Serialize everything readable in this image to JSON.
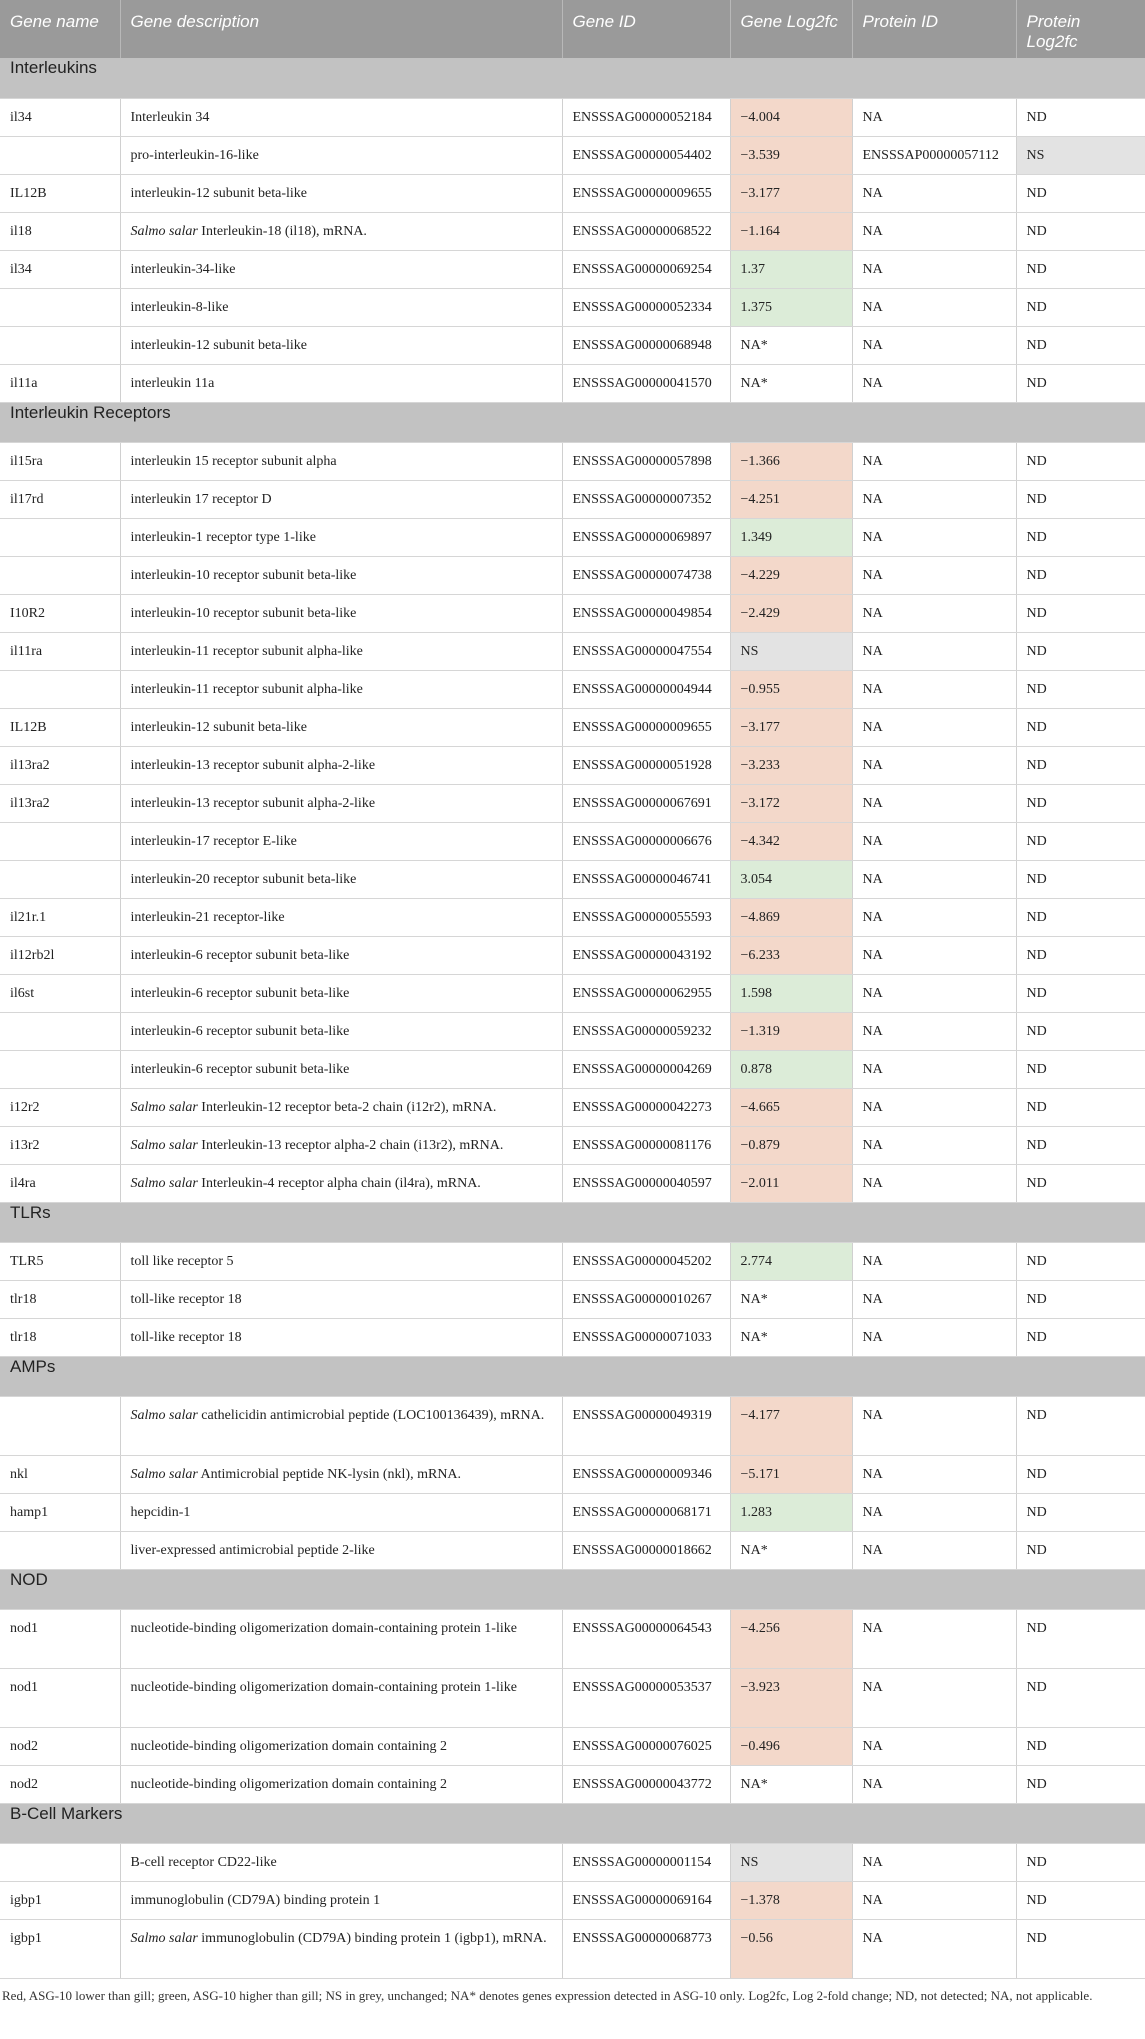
{
  "header": [
    "Gene name",
    "Gene description",
    "Gene ID",
    "Gene Log2fc",
    "Protein ID",
    "Protein Log2fc"
  ],
  "colors": {
    "red": "#f3d8ca",
    "green": "#dcecd8",
    "grey": "#e3e3e3"
  },
  "groups": [
    {
      "title": "Interleukins",
      "rows": [
        {
          "name": "il34",
          "desc": "Interleukin 34",
          "id": "ENSSSAG00000052184",
          "gfc": "−4.004",
          "color": "red",
          "pid": "NA",
          "pfc": "ND"
        },
        {
          "name": "",
          "desc": "pro-interleukin-16-like",
          "id": "ENSSSAG00000054402",
          "gfc": "−3.539",
          "color": "red",
          "pid": "ENSSSAP00000057112",
          "pfc": "NS",
          "pcolor": "grey"
        },
        {
          "name": "IL12B",
          "desc": "interleukin-12 subunit beta-like",
          "id": "ENSSSAG00000009655",
          "gfc": "−3.177",
          "color": "red",
          "pid": "NA",
          "pfc": "ND"
        },
        {
          "name": "il18",
          "desc": "Salmo salar Interleukin-18 (il18), mRNA.",
          "italic": "Salmo salar",
          "id": "ENSSSAG00000068522",
          "gfc": "−1.164",
          "color": "red",
          "pid": "NA",
          "pfc": "ND"
        },
        {
          "name": "il34",
          "desc": "interleukin-34-like",
          "id": "ENSSSAG00000069254",
          "gfc": "1.37",
          "color": "green",
          "pid": "NA",
          "pfc": "ND"
        },
        {
          "name": "",
          "desc": "interleukin-8-like",
          "id": "ENSSSAG00000052334",
          "gfc": "1.375",
          "color": "green",
          "pid": "NA",
          "pfc": "ND"
        },
        {
          "name": "",
          "desc": "interleukin-12 subunit beta-like",
          "id": "ENSSSAG00000068948",
          "gfc": "NA*",
          "color": "",
          "pid": "NA",
          "pfc": "ND"
        },
        {
          "name": "il11a",
          "desc": "interleukin 11a",
          "id": "ENSSSAG00000041570",
          "gfc": "NA*",
          "color": "",
          "pid": "NA",
          "pfc": "ND"
        }
      ]
    },
    {
      "title": "Interleukin Receptors",
      "rows": [
        {
          "name": "il15ra",
          "desc": "interleukin 15 receptor subunit alpha",
          "id": "ENSSSAG00000057898",
          "gfc": "−1.366",
          "color": "red",
          "pid": "NA",
          "pfc": "ND"
        },
        {
          "name": "il17rd",
          "desc": "interleukin 17 receptor D",
          "id": "ENSSSAG00000007352",
          "gfc": "−4.251",
          "color": "red",
          "pid": "NA",
          "pfc": "ND"
        },
        {
          "name": "",
          "desc": "interleukin-1 receptor type 1-like",
          "id": "ENSSSAG00000069897",
          "gfc": "1.349",
          "color": "green",
          "pid": "NA",
          "pfc": "ND"
        },
        {
          "name": "",
          "desc": "interleukin-10 receptor subunit beta-like",
          "id": "ENSSSAG00000074738",
          "gfc": "−4.229",
          "color": "red",
          "pid": "NA",
          "pfc": "ND"
        },
        {
          "name": "I10R2",
          "desc": "interleukin-10 receptor subunit beta-like",
          "id": "ENSSSAG00000049854",
          "gfc": "−2.429",
          "color": "red",
          "pid": "NA",
          "pfc": "ND"
        },
        {
          "name": "il11ra",
          "desc": "interleukin-11 receptor subunit alpha-like",
          "id": "ENSSSAG00000047554",
          "gfc": "NS",
          "color": "grey",
          "pid": "NA",
          "pfc": "ND"
        },
        {
          "name": "",
          "desc": "interleukin-11 receptor subunit alpha-like",
          "id": "ENSSSAG00000004944",
          "gfc": "−0.955",
          "color": "red",
          "pid": "NA",
          "pfc": "ND"
        },
        {
          "name": "IL12B",
          "desc": "interleukin-12 subunit beta-like",
          "id": "ENSSSAG00000009655",
          "gfc": "−3.177",
          "color": "red",
          "pid": "NA",
          "pfc": "ND"
        },
        {
          "name": "il13ra2",
          "desc": "interleukin-13 receptor subunit alpha-2-like",
          "id": "ENSSSAG00000051928",
          "gfc": "−3.233",
          "color": "red",
          "pid": "NA",
          "pfc": "ND"
        },
        {
          "name": "il13ra2",
          "desc": "interleukin-13 receptor subunit alpha-2-like",
          "id": "ENSSSAG00000067691",
          "gfc": "−3.172",
          "color": "red",
          "pid": "NA",
          "pfc": "ND"
        },
        {
          "name": "",
          "desc": "interleukin-17 receptor E-like",
          "id": "ENSSSAG00000006676",
          "gfc": "−4.342",
          "color": "red",
          "pid": "NA",
          "pfc": "ND"
        },
        {
          "name": "",
          "desc": "interleukin-20 receptor subunit beta-like",
          "id": "ENSSSAG00000046741",
          "gfc": "3.054",
          "color": "green",
          "pid": "NA",
          "pfc": "ND"
        },
        {
          "name": "il21r.1",
          "desc": "interleukin-21 receptor-like",
          "id": "ENSSSAG00000055593",
          "gfc": "−4.869",
          "color": "red",
          "pid": "NA",
          "pfc": "ND"
        },
        {
          "name": "il12rb2l",
          "desc": "interleukin-6 receptor subunit beta-like",
          "id": "ENSSSAG00000043192",
          "gfc": "−6.233",
          "color": "red",
          "pid": "NA",
          "pfc": "ND"
        },
        {
          "name": "il6st",
          "desc": "interleukin-6 receptor subunit beta-like",
          "id": "ENSSSAG00000062955",
          "gfc": "1.598",
          "color": "green",
          "pid": "NA",
          "pfc": "ND"
        },
        {
          "name": "",
          "desc": "interleukin-6 receptor subunit beta-like",
          "id": "ENSSSAG00000059232",
          "gfc": "−1.319",
          "color": "red",
          "pid": "NA",
          "pfc": "ND"
        },
        {
          "name": "",
          "desc": "interleukin-6 receptor subunit beta-like",
          "id": "ENSSSAG00000004269",
          "gfc": "0.878",
          "color": "green",
          "pid": "NA",
          "pfc": "ND"
        },
        {
          "name": "i12r2",
          "desc": "Salmo salar Interleukin-12 receptor beta-2 chain (i12r2), mRNA.",
          "italic": "Salmo salar",
          "id": "ENSSSAG00000042273",
          "gfc": "−4.665",
          "color": "red",
          "pid": "NA",
          "pfc": "ND"
        },
        {
          "name": "i13r2",
          "desc": "Salmo salar Interleukin-13 receptor alpha-2 chain (i13r2), mRNA.",
          "italic": "Salmo salar",
          "id": "ENSSSAG00000081176",
          "gfc": "−0.879",
          "color": "red",
          "pid": "NA",
          "pfc": "ND"
        },
        {
          "name": "il4ra",
          "desc": "Salmo salar Interleukin-4 receptor alpha chain (il4ra), mRNA.",
          "italic": "Salmo salar",
          "id": "ENSSSAG00000040597",
          "gfc": "−2.011",
          "color": "red",
          "pid": "NA",
          "pfc": "ND"
        }
      ]
    },
    {
      "title": "TLRs",
      "rows": [
        {
          "name": "TLR5",
          "desc": "toll like receptor 5",
          "id": "ENSSSAG00000045202",
          "gfc": "2.774",
          "color": "green",
          "pid": "NA",
          "pfc": "ND"
        },
        {
          "name": "tlr18",
          "desc": "toll-like receptor 18",
          "id": "ENSSSAG00000010267",
          "gfc": "NA*",
          "color": "",
          "pid": "NA",
          "pfc": "ND"
        },
        {
          "name": "tlr18",
          "desc": "toll-like receptor 18",
          "id": "ENSSSAG00000071033",
          "gfc": "NA*",
          "color": "",
          "pid": "NA",
          "pfc": "ND"
        }
      ]
    },
    {
      "title": "AMPs",
      "rows": [
        {
          "name": "",
          "desc": "Salmo salar cathelicidin antimicrobial peptide (LOC100136439), mRNA.",
          "italic": "Salmo salar",
          "id": "ENSSSAG00000049319",
          "gfc": "−4.177",
          "color": "red",
          "pid": "NA",
          "pfc": "ND",
          "tall": true
        },
        {
          "name": "nkl",
          "desc": "Salmo salar Antimicrobial peptide NK-lysin (nkl), mRNA.",
          "italic": "Salmo salar",
          "id": "ENSSSAG00000009346",
          "gfc": "−5.171",
          "color": "red",
          "pid": "NA",
          "pfc": "ND"
        },
        {
          "name": "hamp1",
          "desc": "hepcidin-1",
          "id": "ENSSSAG00000068171",
          "gfc": "1.283",
          "color": "green",
          "pid": "NA",
          "pfc": "ND"
        },
        {
          "name": "",
          "desc": "liver-expressed antimicrobial peptide 2-like",
          "id": "ENSSSAG00000018662",
          "gfc": "NA*",
          "color": "",
          "pid": "NA",
          "pfc": "ND"
        }
      ]
    },
    {
      "title": "NOD",
      "rows": [
        {
          "name": "nod1",
          "desc": "nucleotide-binding oligomerization domain-containing protein 1-like",
          "id": "ENSSSAG00000064543",
          "gfc": "−4.256",
          "color": "red",
          "pid": "NA",
          "pfc": "ND",
          "tall": true
        },
        {
          "name": "nod1",
          "desc": "nucleotide-binding oligomerization domain-containing protein 1-like",
          "id": "ENSSSAG00000053537",
          "gfc": "−3.923",
          "color": "red",
          "pid": "NA",
          "pfc": "ND",
          "tall": true
        },
        {
          "name": "nod2",
          "desc": "nucleotide-binding oligomerization domain containing 2",
          "id": "ENSSSAG00000076025",
          "gfc": "−0.496",
          "color": "red",
          "pid": "NA",
          "pfc": "ND"
        },
        {
          "name": "nod2",
          "desc": "nucleotide-binding oligomerization domain containing 2",
          "id": "ENSSSAG00000043772",
          "gfc": "NA*",
          "color": "",
          "pid": "NA",
          "pfc": "ND"
        }
      ]
    },
    {
      "title": "B-Cell Markers",
      "rows": [
        {
          "name": "",
          "desc": "B-cell receptor CD22-like",
          "id": "ENSSSAG00000001154",
          "gfc": "NS",
          "color": "grey",
          "pid": "NA",
          "pfc": "ND"
        },
        {
          "name": "igbp1",
          "desc": "immunoglobulin (CD79A) binding protein 1",
          "id": "ENSSSAG00000069164",
          "gfc": "−1.378",
          "color": "red",
          "pid": "NA",
          "pfc": "ND"
        },
        {
          "name": "igbp1",
          "desc": "Salmo salar immunoglobulin (CD79A) binding protein 1 (igbp1), mRNA.",
          "italic": "Salmo salar",
          "id": "ENSSSAG00000068773",
          "gfc": "−0.56",
          "color": "red",
          "pid": "NA",
          "pfc": "ND",
          "tall": true
        }
      ]
    }
  ],
  "footnote": "Red, ASG-10 lower than gill; green, ASG-10 higher than gill; NS in grey, unchanged; NA* denotes genes expression detected in ASG-10 only. Log2fc, Log 2-fold change; ND, not detected; NA, not applicable."
}
